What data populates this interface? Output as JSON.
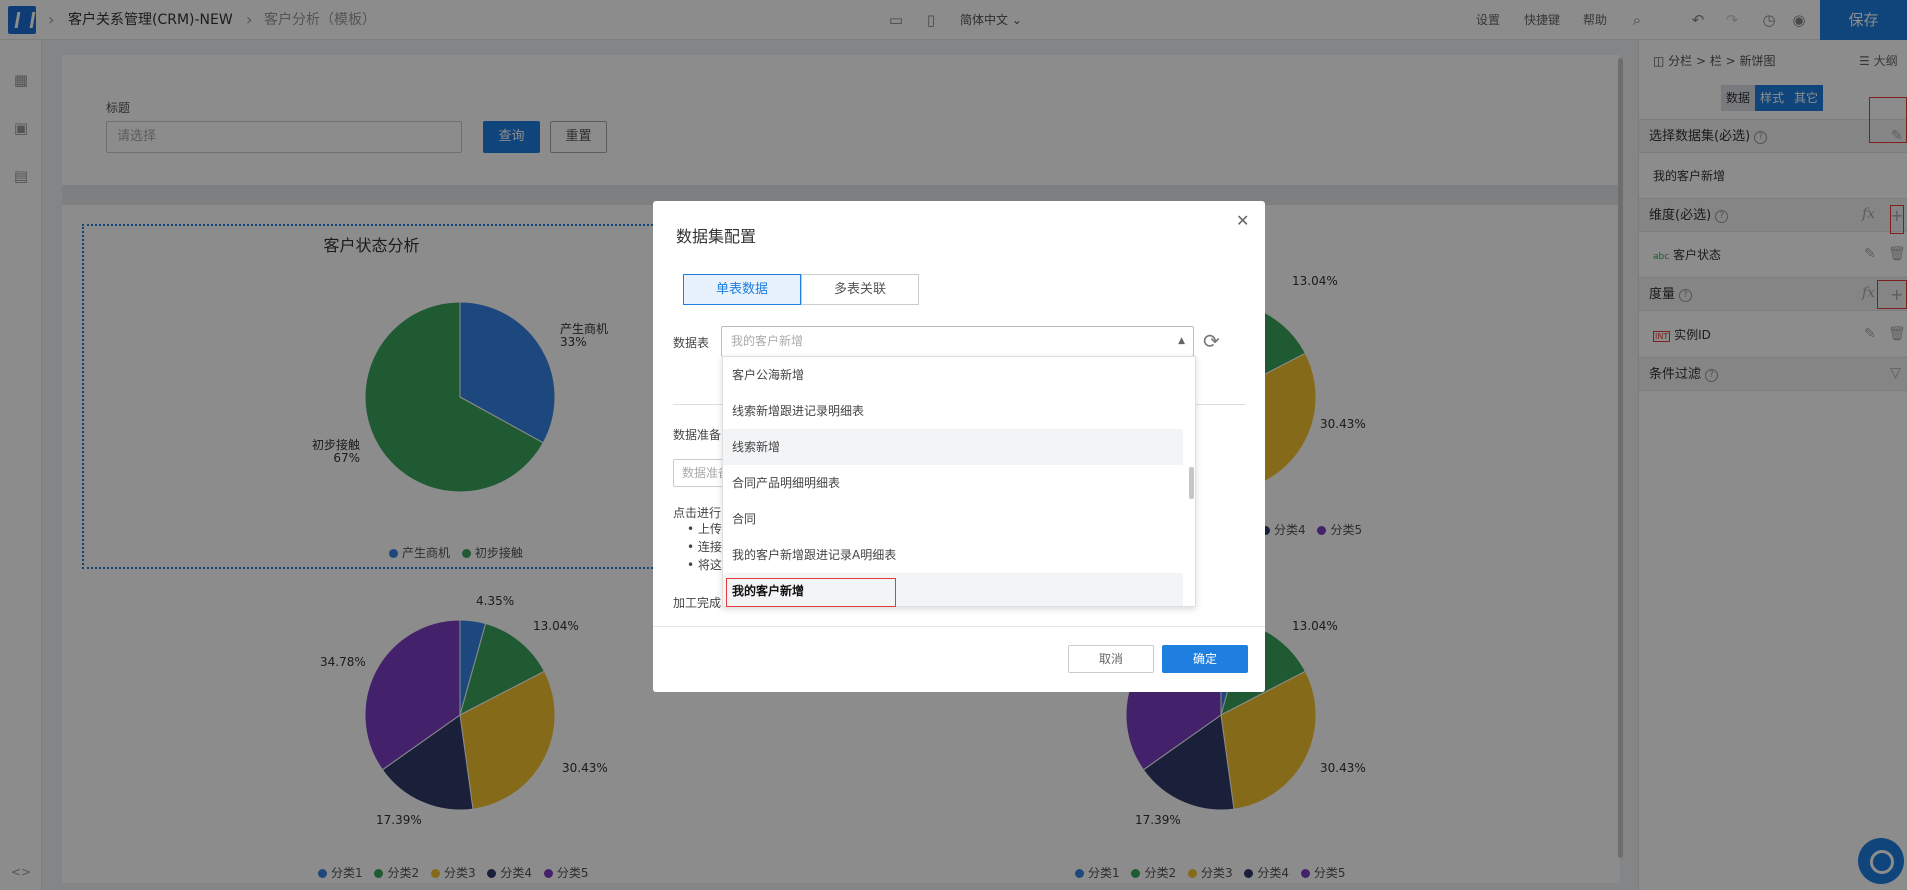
{
  "topbar": {
    "app_title": "客户关系管理(CRM)-NEW",
    "page_title": "客户分析（模板）",
    "language": "简体中文",
    "links": [
      "设置",
      "快捷键",
      "帮助"
    ],
    "save_label": "保存"
  },
  "filter": {
    "label": "标题",
    "placeholder": "请选择",
    "query_label": "查询",
    "reset_label": "重置"
  },
  "charts": {
    "main": {
      "title": "客户状态分析",
      "legend": [
        "产生商机",
        "初步接触"
      ],
      "labels": [
        {
          "name": "产生商机",
          "pct": "33%"
        },
        {
          "name": "初步接触",
          "pct": "67%"
        }
      ]
    },
    "category_legend": [
      "分类1",
      "分类2",
      "分类3",
      "分类4",
      "分类5"
    ],
    "pct_labels": [
      "4.35%",
      "13.04%",
      "30.43%",
      "17.39%",
      "34.78%"
    ]
  },
  "chart_data": [
    {
      "type": "pie",
      "title": "客户状态分析",
      "categories": [
        "产生商机",
        "初步接触"
      ],
      "values": [
        33,
        67
      ],
      "colors": [
        "#3584e4",
        "#3aa55b"
      ]
    },
    {
      "type": "pie",
      "categories": [
        "分类1",
        "分类2",
        "分类3",
        "分类4",
        "分类5"
      ],
      "values": [
        4.35,
        13.04,
        30.43,
        17.39,
        34.78
      ],
      "colors": [
        "#3584e4",
        "#3aa55b",
        "#f2c12e",
        "#30396b",
        "#7c3fc4"
      ]
    },
    {
      "type": "pie",
      "categories": [
        "分类1",
        "分类2",
        "分类3",
        "分类4",
        "分类5"
      ],
      "values": [
        4.35,
        13.04,
        30.43,
        17.39,
        34.78
      ],
      "colors": [
        "#3584e4",
        "#3aa55b",
        "#f2c12e",
        "#30396b",
        "#7c3fc4"
      ]
    },
    {
      "type": "pie",
      "categories": [
        "分类1",
        "分类2",
        "分类3",
        "分类4",
        "分类5"
      ],
      "values": [
        4.35,
        13.04,
        30.43,
        17.39,
        34.78
      ],
      "colors": [
        "#3584e4",
        "#3aa55b",
        "#f2c12e",
        "#30396b",
        "#7c3fc4"
      ]
    }
  ],
  "right_panel": {
    "breadcrumb": "分栏 > 栏 > 新饼图",
    "outline": "大纲",
    "tabs": [
      "数据",
      "样式",
      "其它"
    ],
    "dataset_section": "选择数据集(必选)",
    "dataset_value": "我的客户新增",
    "dimension_section": "维度(必选)",
    "dimension_tag": "abc",
    "dimension_value": "客户状态",
    "measure_section": "度量",
    "measure_tag": "INT",
    "measure_value": "实例ID",
    "filter_section": "条件过滤",
    "fx": "fx"
  },
  "modal": {
    "title": "数据集配置",
    "tab_single": "单表数据",
    "tab_multi": "多表关联",
    "table_label": "数据表",
    "table_placeholder": "我的客户新增",
    "prep_label": "数据准备",
    "prep_input": "数据准备",
    "hint": "点击进行",
    "bullets": [
      "上传数",
      "连接数",
      "将这些"
    ],
    "done_label": "加工完成",
    "cancel_label": "取消",
    "ok_label": "确定",
    "dropdown_items": [
      "客户公海新增",
      "线索新增跟进记录明细表",
      "线索新增",
      "合同产品明细明细表",
      "合同",
      "我的客户新增跟进记录A明细表",
      "我的客户新增"
    ]
  },
  "colors": {
    "accent": "#1e7fe0",
    "series": [
      "#3584e4",
      "#3aa55b",
      "#f2c12e",
      "#30396b",
      "#7c3fc4"
    ]
  }
}
